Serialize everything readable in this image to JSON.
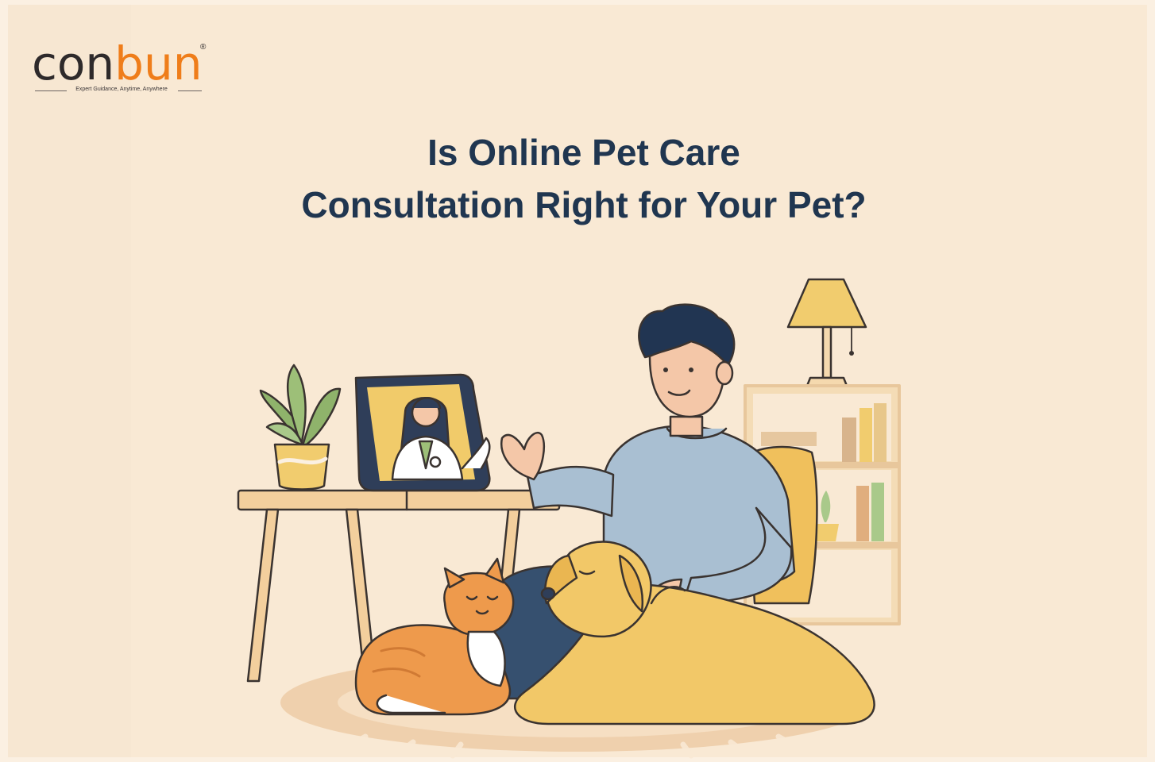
{
  "brand": {
    "logo_part1": "con",
    "logo_part2": "bun",
    "registered": "®",
    "tagline": "Expert Guidance, Anytime, Anywhere",
    "colors": {
      "dark": "#2e2a2b",
      "orange": "#ef7d1a"
    }
  },
  "headline": {
    "line1": "Is Online Pet Care",
    "line2": "Consultation Right for Your Pet?"
  },
  "colors": {
    "background": "#f9e9d4",
    "headline": "#203650",
    "sweater": "#a9bfd2",
    "dog": "#f2c868",
    "cat": "#ee9a4c"
  }
}
